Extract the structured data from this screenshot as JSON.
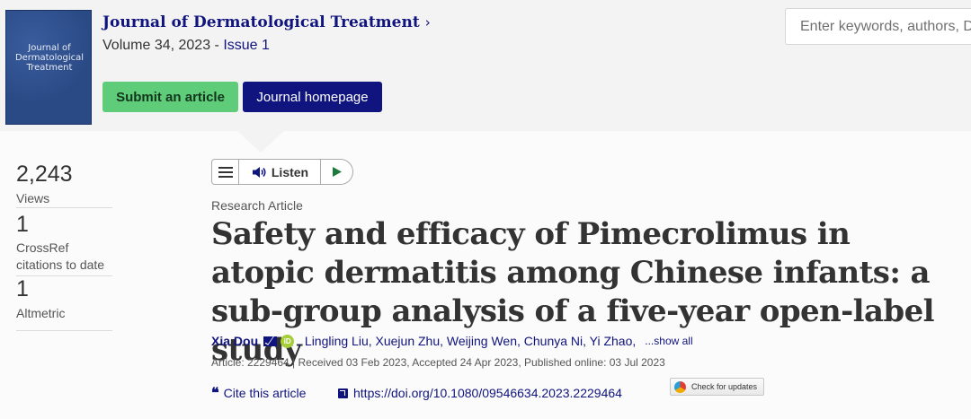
{
  "journal": {
    "cover_text": "Journal of Dermatological Treatment",
    "title": "Journal of Dermatological Treatment",
    "title_chevron": "›",
    "volume": "Volume 34, 2023 - ",
    "issue": "Issue 1"
  },
  "actions": {
    "submit_label": "Submit an article",
    "homepage_label": "Journal homepage"
  },
  "search": {
    "placeholder": "Enter keywords, authors, DOI"
  },
  "metrics": [
    {
      "value": "2,243",
      "label": "Views"
    },
    {
      "value": "1",
      "label": "CrossRef citations to date"
    },
    {
      "value": "1",
      "label": "Altmetric"
    }
  ],
  "toolbar": {
    "listen_label": "Listen"
  },
  "article": {
    "type": "Research Article",
    "title": "Safety and efficacy of Pimecrolimus in atopic dermatitis among Chinese infants: a sub-group analysis of a five-year open-label study",
    "first_author": "Xia Dou",
    "other_authors": ", Lingling Liu, Xuejun Zhu, Weijing Wen, Chunya Ni, Yi Zhao,",
    "show_all": "...show all",
    "meta": "Article: 2229464 | Received 03 Feb 2023, Accepted 24 Apr 2023, Published online: 03 Jul 2023",
    "cite_label": "Cite this article",
    "doi": "https://doi.org/10.1080/09546634.2023.2229464",
    "updates_label": "Check for updates"
  },
  "colors": {
    "brand_navy": "#10147e",
    "submit_green": "#5fcc7a",
    "orcid_green": "#a6ce39"
  },
  "icons": [
    "chevron-right-icon",
    "menu-icon",
    "speaker-icon",
    "play-icon",
    "mail-icon",
    "orcid-icon",
    "quote-icon",
    "external-link-icon",
    "crossmark-icon"
  ]
}
